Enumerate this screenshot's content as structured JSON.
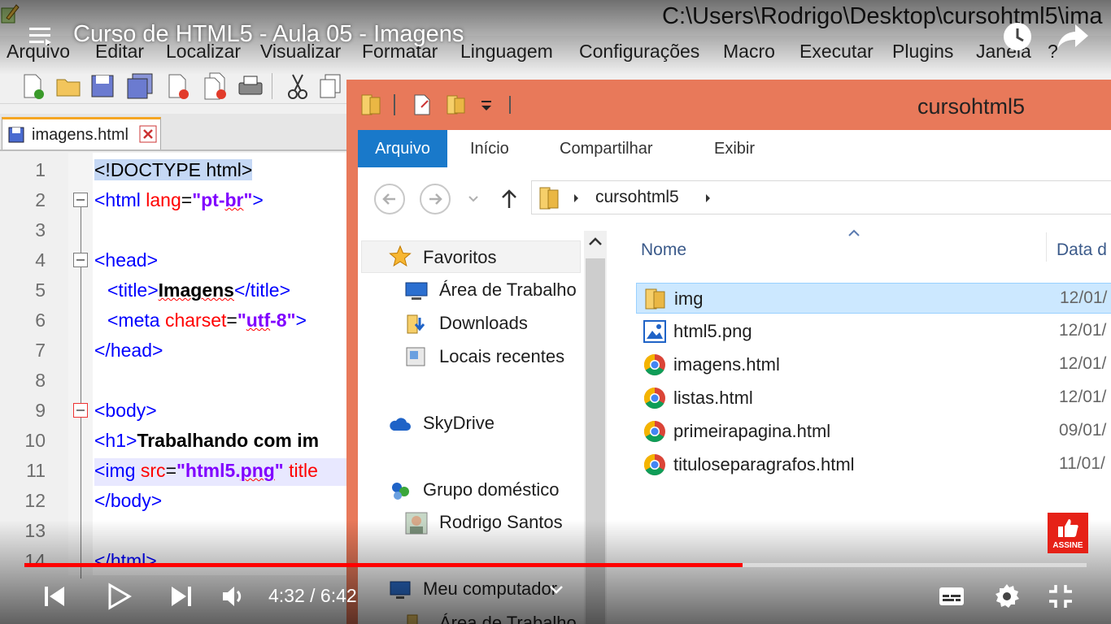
{
  "notepad": {
    "window_path": "C:\\Users\\Rodrigo\\Desktop\\cursohtml5\\ima",
    "menu": [
      "Arquivo",
      "Editar",
      "Localizar",
      "Visualizar",
      "Formatar",
      "Linguagem",
      "Configurações",
      "Macro",
      "Executar",
      "Plugins",
      "Janela",
      "?"
    ],
    "tab_label": "imagens.html",
    "line_numbers": [
      "1",
      "2",
      "3",
      "4",
      "5",
      "6",
      "7",
      "8",
      "9",
      "10",
      "11",
      "12",
      "13",
      "14"
    ],
    "code": {
      "l1": "<!DOCTYPE html>",
      "l2_open": "<html ",
      "l2_attr": "lang",
      "l2_eq": "=",
      "l2_val_a": "\"pt-",
      "l2_val_b": "br",
      "l2_val_c": "\"",
      "l2_close": ">",
      "l4": "<head>",
      "l5_open": "<title>",
      "l5_text": "Imagens",
      "l5_close": "</title>",
      "l6_open": "<meta ",
      "l6_attr": "charset",
      "l6_eq": "=",
      "l6_val_a": "\"",
      "l6_val_b": "utf",
      "l6_val_c": "-8\"",
      "l6_close": ">",
      "l7": "</head>",
      "l9": "<body>",
      "l10_open": "<h1>",
      "l10_text": "Trabalhando com im",
      "l11_open": "<img ",
      "l11_attr": "src",
      "l11_eq": "=",
      "l11_val_a": "\"html5.",
      "l11_val_b": "png",
      "l11_val_c": "\" ",
      "l11_attr2": "title",
      "l12": "</body>",
      "l14": "</html>"
    }
  },
  "explorer": {
    "title": "cursohtml5",
    "ribbon_tabs": [
      "Arquivo",
      "Início",
      "Compartilhar",
      "Exibir"
    ],
    "address_segment": "cursohtml5",
    "nav": {
      "favorites": "Favoritos",
      "desktop": "Área de Trabalho",
      "downloads": "Downloads",
      "recent": "Locais recentes",
      "skydrive": "SkyDrive",
      "homegroup": "Grupo doméstico",
      "user": "Rodrigo Santos",
      "computer": "Meu computador",
      "desktop2": "Área de Trabalho"
    },
    "columns": {
      "name": "Nome",
      "date": "Data d"
    },
    "files": [
      {
        "name": "img",
        "date": "12/01/",
        "icon": "folder-icon",
        "selected": true
      },
      {
        "name": "html5.png",
        "date": "12/01/",
        "icon": "image-icon",
        "selected": false
      },
      {
        "name": "imagens.html",
        "date": "12/01/",
        "icon": "chrome-icon",
        "selected": false
      },
      {
        "name": "listas.html",
        "date": "12/01/",
        "icon": "chrome-icon",
        "selected": false
      },
      {
        "name": "primeirapagina.html",
        "date": "09/01/",
        "icon": "chrome-icon",
        "selected": false
      },
      {
        "name": "tituloseparagrafos.html",
        "date": "11/01/",
        "icon": "chrome-icon",
        "selected": false
      }
    ]
  },
  "player": {
    "video_title": "Curso de HTML5 - Aula 05 - Imagens",
    "time_current": "4:32",
    "time_total": "6:42",
    "time_display": "4:32 / 6:42",
    "progress_fraction": 0.676,
    "subscribe_label": "ASSINE",
    "accent_color": "#ff0000"
  }
}
